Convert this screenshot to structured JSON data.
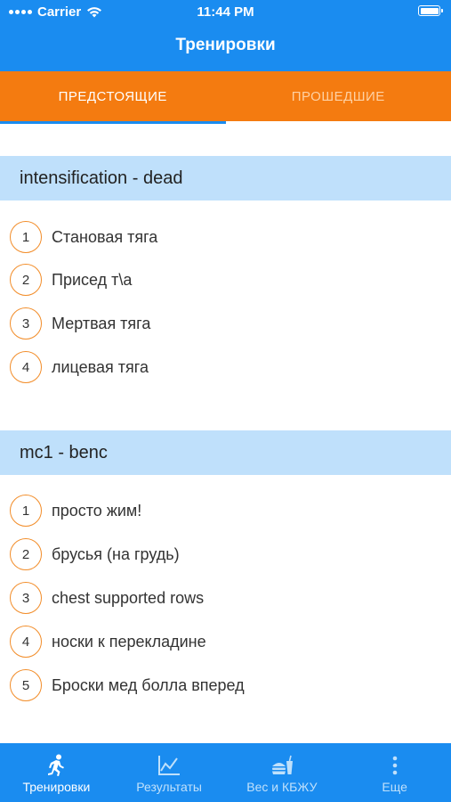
{
  "status_bar": {
    "carrier": "Carrier",
    "time": "11:44 PM"
  },
  "nav": {
    "title": "Тренировки"
  },
  "tabs": [
    {
      "label": "ПРЕДСТОЯЩИЕ",
      "active": true
    },
    {
      "label": "ПРОШЕДШИЕ",
      "active": false
    }
  ],
  "workouts": [
    {
      "title": "intensification - dead",
      "exercises": [
        {
          "num": "1",
          "name": "Становая тяга"
        },
        {
          "num": "2",
          "name": "Присед т\\а"
        },
        {
          "num": "3",
          "name": "Мертвая тяга"
        },
        {
          "num": "4",
          "name": "лицевая тяга"
        }
      ]
    },
    {
      "title": "mc1 - benc",
      "exercises": [
        {
          "num": "1",
          "name": "просто жим!"
        },
        {
          "num": "2",
          "name": "брусья (на грудь)"
        },
        {
          "num": "3",
          "name": "chest supported rows"
        },
        {
          "num": "4",
          "name": "носки к перекладине"
        },
        {
          "num": "5",
          "name": "Броски мед болла вперед"
        }
      ]
    }
  ],
  "tabbar": [
    {
      "label": "Тренировки",
      "icon": "runner-icon",
      "active": true
    },
    {
      "label": "Результаты",
      "icon": "chart-icon",
      "active": false
    },
    {
      "label": "Вес и КБЖУ",
      "icon": "food-icon",
      "active": false
    },
    {
      "label": "Еще",
      "icon": "more-icon",
      "active": false
    }
  ],
  "colors": {
    "primary": "#1a8cf0",
    "accent": "#f47b10",
    "section_bg": "#bfe0fb",
    "circle_border": "#f28c28"
  }
}
